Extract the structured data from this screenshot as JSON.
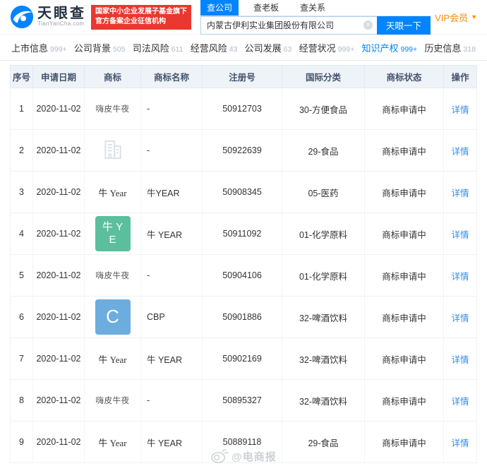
{
  "colors": {
    "brand_blue": "#0084ff",
    "badge_red": "#e8382f",
    "vip_orange": "#ff8a00",
    "link_blue": "#2e8ded",
    "green_mark": "#5bbf9e",
    "blue_mark": "#6caddf"
  },
  "header": {
    "logo_title": "天眼查",
    "logo_subtitle": "TianYanCha.com",
    "badge_line1": "国家中小企业发展子基金旗下",
    "badge_line2": "官方备案企业征信机构",
    "search_tabs": [
      {
        "label": "查公司",
        "active": true
      },
      {
        "label": "查老板",
        "active": false
      },
      {
        "label": "查关系",
        "active": false
      }
    ],
    "search_value": "内蒙古伊利实业集团股份有限公司",
    "search_button": "天眼一下",
    "vip_label": "VIP会员"
  },
  "nav": {
    "items": [
      {
        "label": "上市信息",
        "count": "999+",
        "active": false
      },
      {
        "label": "公司背景",
        "count": "505",
        "active": false
      },
      {
        "label": "司法风险",
        "count": "611",
        "active": false
      },
      {
        "label": "经营风险",
        "count": "43",
        "active": false
      },
      {
        "label": "公司发展",
        "count": "63",
        "active": false
      },
      {
        "label": "经营状况",
        "count": "999+",
        "active": false
      },
      {
        "label": "知识产权",
        "count": "999+",
        "active": true
      },
      {
        "label": "历史信息",
        "count": "318",
        "active": false
      }
    ]
  },
  "table": {
    "headers": [
      "序号",
      "申请日期",
      "商标",
      "商标名称",
      "注册号",
      "国际分类",
      "商标状态",
      "操作"
    ],
    "action_label": "详情",
    "rows": [
      {
        "no": "1",
        "date": "2020-11-02",
        "mark": {
          "kind": "text",
          "text": "嗨皮牛夜"
        },
        "name": "-",
        "reg_no": "50912703",
        "intl_class": "30-方便食品",
        "status": "商标申请中"
      },
      {
        "no": "2",
        "date": "2020-11-02",
        "mark": {
          "kind": "placeholder",
          "icon": "building-placeholder-icon"
        },
        "name": "-",
        "reg_no": "50922639",
        "intl_class": "29-食品",
        "status": "商标申请中"
      },
      {
        "no": "3",
        "date": "2020-11-02",
        "mark": {
          "kind": "serif-text",
          "text": "牛 Year"
        },
        "name": "牛YEAR",
        "reg_no": "50908345",
        "intl_class": "05-医药",
        "status": "商标申请中"
      },
      {
        "no": "4",
        "date": "2020-11-02",
        "mark": {
          "kind": "badge",
          "color_key": "green_mark",
          "lines": [
            "牛 Y",
            "E"
          ]
        },
        "name": "牛 YEAR",
        "reg_no": "50911092",
        "intl_class": "01-化学原料",
        "status": "商标申请中"
      },
      {
        "no": "5",
        "date": "2020-11-02",
        "mark": {
          "kind": "text",
          "text": "嗨皮牛夜"
        },
        "name": "-",
        "reg_no": "50904106",
        "intl_class": "01-化学原料",
        "status": "商标申请中"
      },
      {
        "no": "6",
        "date": "2020-11-02",
        "mark": {
          "kind": "badge",
          "color_key": "blue_mark",
          "lines": [
            "C"
          ]
        },
        "name": "CBP",
        "reg_no": "50901886",
        "intl_class": "32-啤酒饮料",
        "status": "商标申请中"
      },
      {
        "no": "7",
        "date": "2020-11-02",
        "mark": {
          "kind": "serif-text",
          "text": "牛 Year"
        },
        "name": "牛 YEAR",
        "reg_no": "50902169",
        "intl_class": "32-啤酒饮料",
        "status": "商标申请中"
      },
      {
        "no": "8",
        "date": "2020-11-02",
        "mark": {
          "kind": "text",
          "text": "嗨皮牛夜"
        },
        "name": "-",
        "reg_no": "50895327",
        "intl_class": "32-啤酒饮料",
        "status": "商标申请中"
      },
      {
        "no": "9",
        "date": "2020-11-02",
        "mark": {
          "kind": "serif-text",
          "text": "牛 Year"
        },
        "name": "牛 YEAR",
        "reg_no": "50889118",
        "intl_class": "29-食品",
        "status": "商标申请中"
      }
    ]
  },
  "watermark": "@电商报"
}
